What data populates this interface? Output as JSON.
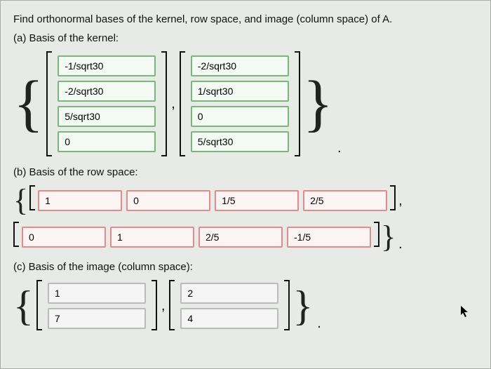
{
  "prompt": "Find orthonormal bases of the kernel, row space, and image (column space) of A.",
  "parts": {
    "a": {
      "label": "(a) Basis of the kernel:",
      "vec1": [
        "-1/sqrt30",
        "-2/sqrt30",
        "5/sqrt30",
        "0"
      ],
      "vec2": [
        "-2/sqrt30",
        "1/sqrt30",
        "0",
        "5/sqrt30"
      ]
    },
    "b": {
      "label": "(b) Basis of the row space:",
      "vec1": [
        "1",
        "0",
        "1/5",
        "2/5"
      ],
      "vec2": [
        "0",
        "1",
        "2/5",
        "-1/5"
      ]
    },
    "c": {
      "label": "(c) Basis of the image (column space):",
      "vec1": [
        "1",
        "7"
      ],
      "vec2": [
        "2",
        "4"
      ]
    }
  }
}
